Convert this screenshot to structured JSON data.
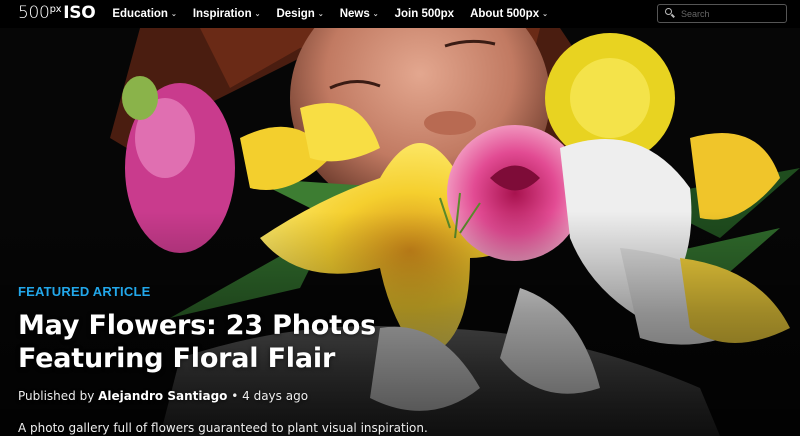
{
  "logo": {
    "num": "500",
    "sup": "px",
    "suffix": "ISO"
  },
  "nav": {
    "items": [
      {
        "label": "Education",
        "dropdown": true
      },
      {
        "label": "Inspiration",
        "dropdown": true
      },
      {
        "label": "Design",
        "dropdown": true
      },
      {
        "label": "News",
        "dropdown": true
      },
      {
        "label": "Join 500px",
        "dropdown": false
      },
      {
        "label": "About 500px",
        "dropdown": true
      }
    ],
    "caret": "⌄"
  },
  "search": {
    "placeholder": "Search",
    "icon": "search-icon"
  },
  "article": {
    "kicker": "FEATURED ARTICLE",
    "title_line1": "May Flowers: 23 Photos",
    "title_line2": "Featuring Floral Flair",
    "published_prefix": "Published by ",
    "author": "Alejandro Santiago",
    "separator": " • ",
    "time": "4 days ago",
    "dek": "A photo gallery full of flowers guaranteed to plant visual inspiration."
  },
  "colors": {
    "accent": "#22a7ea",
    "background": "#000000"
  }
}
